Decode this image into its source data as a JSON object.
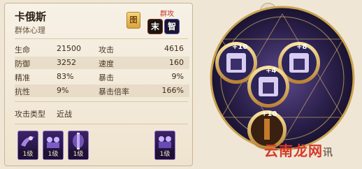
{
  "hero": {
    "name": "卡俄斯",
    "type": "群体心理",
    "badge_gold": "囹",
    "aoe_label": "群攻",
    "badge1": "末",
    "badge2": "智"
  },
  "stats": [
    {
      "l1": "生命",
      "v1": "21500",
      "l2": "攻击",
      "v2": "4616"
    },
    {
      "l1": "防御",
      "v1": "3252",
      "l2": "速度",
      "v2": "160"
    },
    {
      "l1": "精准",
      "v1": "83%",
      "l2": "暴击",
      "v2": "9%"
    },
    {
      "l1": "抗性",
      "v1": "9%",
      "l2": "暴击倍率",
      "v2": "166%"
    }
  ],
  "attack_type": {
    "label": "攻击类型",
    "value": "近战"
  },
  "skills": [
    {
      "level": "1级"
    },
    {
      "level": "1级"
    },
    {
      "level": "1级"
    },
    {
      "level": "1级"
    }
  ],
  "wheel": {
    "top_left": "+10",
    "top_right": "+8",
    "center": "+4",
    "bottom": "+10"
  },
  "watermark": {
    "main": "云南龙网",
    "sub": "讯"
  },
  "colors": {
    "accent": "#d4a84a",
    "panel": "#f4ecdd",
    "dark_purple": "#2a1b4e"
  },
  "icons": [
    "close-icon",
    "gold-badge",
    "skill-icons",
    "gear-wheel"
  ]
}
